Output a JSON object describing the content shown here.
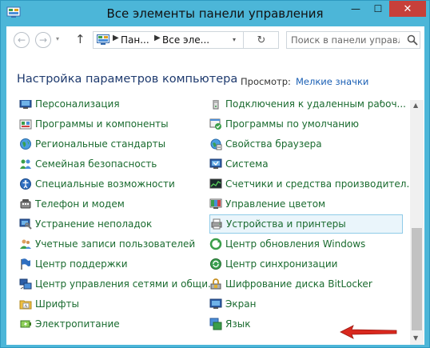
{
  "window": {
    "title": "Все элементы панели управления",
    "minimize": "—",
    "maximize": "☐",
    "close": "✕"
  },
  "nav": {
    "back": "←",
    "forward": "→",
    "history": "▾",
    "up": "↑",
    "crumbs": [
      "Пан...",
      "Все эле..."
    ],
    "crumb_separator": "▶",
    "address_dropdown": "▾",
    "refresh": "↻",
    "search_placeholder": "Поиск в панели управл..."
  },
  "header": {
    "title": "Настройка параметров компьютера",
    "view_label": "Просмотр:",
    "view_value": "Мелкие значки"
  },
  "items_left": [
    {
      "label": "Персонализация",
      "icon": "personalization-icon"
    },
    {
      "label": "Программы и компоненты",
      "icon": "programs-icon"
    },
    {
      "label": "Региональные стандарты",
      "icon": "region-globe-icon"
    },
    {
      "label": "Семейная безопасность",
      "icon": "family-safety-icon"
    },
    {
      "label": "Специальные возможности",
      "icon": "accessibility-icon"
    },
    {
      "label": "Телефон и модем",
      "icon": "phone-modem-icon"
    },
    {
      "label": "Устранение неполадок",
      "icon": "troubleshooting-icon"
    },
    {
      "label": "Учетные записи пользователей",
      "icon": "user-accounts-icon"
    },
    {
      "label": "Центр поддержки",
      "icon": "action-center-flag-icon"
    },
    {
      "label": "Центр управления сетями и общи...",
      "icon": "network-center-icon"
    },
    {
      "label": "Шрифты",
      "icon": "fonts-folder-icon"
    },
    {
      "label": "Электропитание",
      "icon": "power-options-icon"
    }
  ],
  "items_right": [
    {
      "label": "Подключения к удаленным рабоч...",
      "icon": "remote-connections-icon"
    },
    {
      "label": "Программы по умолчанию",
      "icon": "default-programs-icon"
    },
    {
      "label": "Свойства браузера",
      "icon": "browser-properties-icon"
    },
    {
      "label": "Система",
      "icon": "system-icon"
    },
    {
      "label": "Счетчики и средства производител...",
      "icon": "performance-icon"
    },
    {
      "label": "Управление цветом",
      "icon": "color-management-icon"
    },
    {
      "label": "Устройства и принтеры",
      "icon": "devices-printers-icon"
    },
    {
      "label": "Центр обновления Windows",
      "icon": "windows-update-icon"
    },
    {
      "label": "Центр синхронизации",
      "icon": "sync-center-icon"
    },
    {
      "label": "Шифрование диска BitLocker",
      "icon": "bitlocker-icon"
    },
    {
      "label": "Экран",
      "icon": "display-icon"
    },
    {
      "label": "Язык",
      "icon": "language-icon"
    }
  ],
  "scrollbar": {
    "up": "▲",
    "down": "▼"
  },
  "colors": {
    "titlebar": "#4cb6d8",
    "link_green": "#1a6b2f",
    "heading_blue": "#1e3a6e",
    "close_red": "#c7403a",
    "arrow_red": "#d9281e"
  }
}
